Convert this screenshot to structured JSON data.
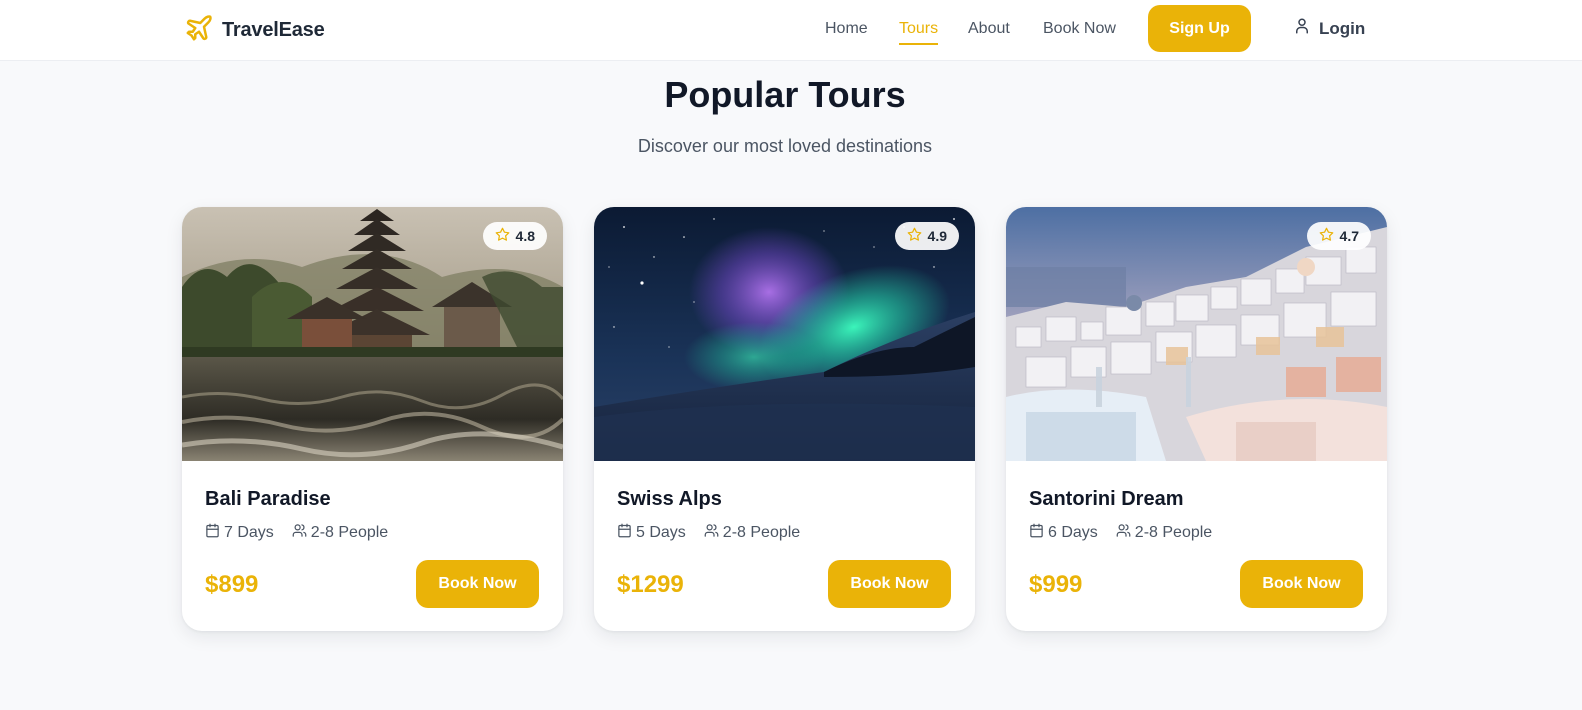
{
  "brand": {
    "name": "TravelEase",
    "icon": "plane-icon"
  },
  "nav": {
    "links": [
      "Home",
      "Tours",
      "About",
      "Book Now"
    ],
    "active": "Tours",
    "signup": "Sign Up",
    "login": "Login"
  },
  "section": {
    "title": "Popular Tours",
    "subtitle": "Discover our most loved destinations"
  },
  "tours": [
    {
      "name": "Bali Paradise",
      "rating": "4.8",
      "duration": "7 Days",
      "group": "2-8 People",
      "price": "$899",
      "cta": "Book Now"
    },
    {
      "name": "Swiss Alps",
      "rating": "4.9",
      "duration": "5 Days",
      "group": "2-8 People",
      "price": "$1299",
      "cta": "Book Now"
    },
    {
      "name": "Santorini Dream",
      "rating": "4.7",
      "duration": "6 Days",
      "group": "2-8 People",
      "price": "$999",
      "cta": "Book Now"
    }
  ],
  "colors": {
    "accent": "#eab308",
    "background": "#f8f9fb",
    "text": "#111827",
    "muted": "#4b5563"
  }
}
